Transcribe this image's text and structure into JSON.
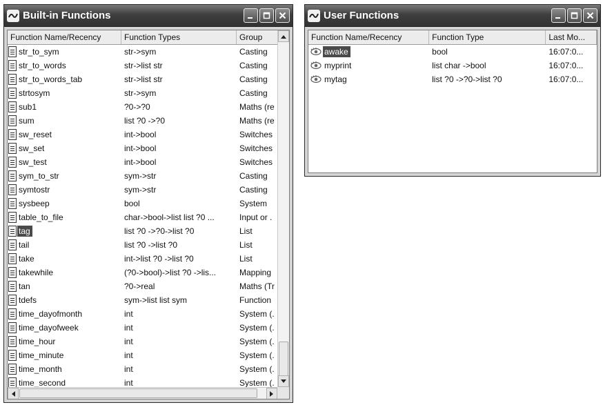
{
  "builtin": {
    "title": "Built-in Functions",
    "columns": [
      "Function Name/Recency",
      "Function Types",
      "Group"
    ],
    "rows": [
      {
        "name": "str_to_sym",
        "type": "str->sym",
        "group": "Casting"
      },
      {
        "name": "str_to_words",
        "type": "str->list str",
        "group": "Casting"
      },
      {
        "name": "str_to_words_tab",
        "type": "str->list str",
        "group": "Casting"
      },
      {
        "name": "strtosym",
        "type": "str->sym",
        "group": "Casting"
      },
      {
        "name": "sub1",
        "type": "?0->?0",
        "group": "Maths (re"
      },
      {
        "name": "sum",
        "type": "list ?0 ->?0",
        "group": "Maths (re"
      },
      {
        "name": "sw_reset",
        "type": "int->bool",
        "group": "Switches"
      },
      {
        "name": "sw_set",
        "type": "int->bool",
        "group": "Switches"
      },
      {
        "name": "sw_test",
        "type": "int->bool",
        "group": "Switches"
      },
      {
        "name": "sym_to_str",
        "type": "sym->str",
        "group": "Casting"
      },
      {
        "name": "symtostr",
        "type": "sym->str",
        "group": "Casting"
      },
      {
        "name": "sysbeep",
        "type": "bool",
        "group": "System"
      },
      {
        "name": "table_to_file",
        "type": "char->bool->list list ?0 ...",
        "group": "Input or ."
      },
      {
        "name": "tag",
        "type": "list ?0 ->?0->list ?0",
        "group": "List",
        "selected": true
      },
      {
        "name": "tail",
        "type": "list ?0 ->list ?0",
        "group": "List"
      },
      {
        "name": "take",
        "type": "int->list ?0 ->list ?0",
        "group": "List"
      },
      {
        "name": "takewhile",
        "type": "(?0->bool)->list ?0 ->lis...",
        "group": "Mapping"
      },
      {
        "name": "tan",
        "type": "?0->real",
        "group": "Maths (Tr"
      },
      {
        "name": "tdefs",
        "type": "sym->list list sym",
        "group": "Function"
      },
      {
        "name": "time_dayofmonth",
        "type": "int",
        "group": "System (."
      },
      {
        "name": "time_dayofweek",
        "type": "int",
        "group": "System (."
      },
      {
        "name": "time_hour",
        "type": "int",
        "group": "System (."
      },
      {
        "name": "time_minute",
        "type": "int",
        "group": "System (."
      },
      {
        "name": "time_month",
        "type": "int",
        "group": "System (."
      },
      {
        "name": "time_second",
        "type": "int",
        "group": "System (."
      }
    ]
  },
  "user": {
    "title": "User Functions",
    "columns": [
      "Function Name/Recency",
      "Function Type",
      "Last Mo..."
    ],
    "rows": [
      {
        "name": "awake",
        "type": "bool",
        "modified": "16:07:0...",
        "selected": true
      },
      {
        "name": "myprint",
        "type": "list char ->bool",
        "modified": "16:07:0..."
      },
      {
        "name": "mytag",
        "type": "list ?0 ->?0->list ?0",
        "modified": "16:07:0..."
      }
    ]
  },
  "icons": {
    "app": "app-logo-icon",
    "builtin_row": "document-icon",
    "user_row": "eye-icon",
    "minimize": "minimize-icon",
    "maximize": "maximize-icon",
    "close": "close-icon"
  }
}
